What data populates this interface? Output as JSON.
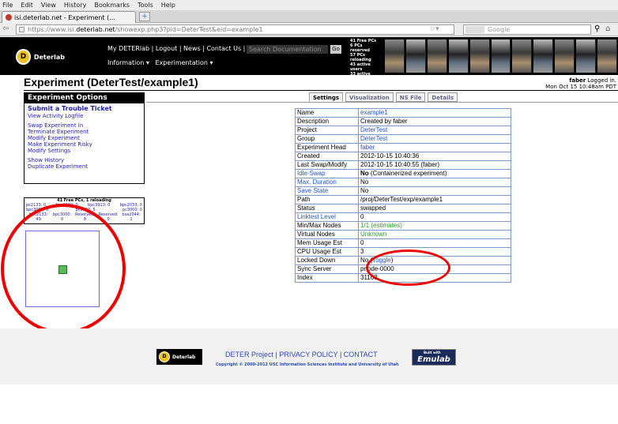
{
  "browser": {
    "menu": [
      "File",
      "Edit",
      "View",
      "History",
      "Bookmarks",
      "Tools",
      "Help"
    ],
    "tab_title": "isi.deterlab.net - Experiment (...",
    "new_tab": "+",
    "url_prefix": "https://www.isi.",
    "url_domain": "deterlab.net",
    "url_path": "/showexp.php3?pid=DeterTest&eid=example1",
    "search_placeholder": "Google"
  },
  "site": {
    "logo_text": "Deterlab",
    "logo_letter": "D",
    "toplinks": "My DETERlab | Logout | News | Contact Us |",
    "doc_search_placeholder": "Search Documentation",
    "go_label": "Go",
    "menu_information": "Information ▾",
    "menu_experimentation": "Experimentation ▾",
    "free_pcs": [
      "41 Free PCs",
      "6 PCs reserved",
      "57 PCs reloading",
      "43 active users",
      "33 active expts."
    ]
  },
  "page": {
    "title": "Experiment (DeterTest/example1)",
    "logged_in_user": "faber",
    "logged_in_suffix": " Logged in.",
    "datetime": "Mon Oct 15 10:48am PDT"
  },
  "sidebar": {
    "header": "Experiment Options",
    "items": [
      "Submit a Trouble Ticket",
      "View Activity Logfile",
      "Swap Experiment In",
      "Terminate Experiment",
      "Modify Experiment",
      "Make Experiment Risky",
      "Modify Settings",
      "Show History",
      "Duplicate Experiment"
    ],
    "freepcs_header": "41 Free PCs, 1 reloading",
    "freepcs_rows": [
      [
        "pc2133: 0",
        "bpc2000: 0",
        "bpc3913: 0",
        "bpc2033: 0"
      ],
      [
        "bpc3000: 0",
        "pc3060: 5",
        "pc3000: 0"
      ],
      [
        "bpc2133: 49",
        "bpc3000: 0",
        "Reserved: 8",
        "Reserved: 0",
        "bsa2044: 2"
      ]
    ]
  },
  "tabs": [
    "Settings",
    "Visualization",
    "NS File",
    "Details"
  ],
  "details": [
    {
      "key": "Name",
      "value": "example1"
    },
    {
      "key": "Description",
      "value": "Created by faber"
    },
    {
      "key": "Project",
      "value": "DeterTest"
    },
    {
      "key": "Group",
      "value": "DeterTest"
    },
    {
      "key": "Experiment Head",
      "value": "faber"
    },
    {
      "key": "Created",
      "value": "2012-10-15 10:40:36"
    },
    {
      "key": "Last Swap/Modify",
      "value": "2012-10-15 10:40:55 (faber)"
    },
    {
      "key": "Idle-Swap",
      "value": "No",
      "note": " (Containerized experiment)"
    },
    {
      "key": "Max. Duration",
      "value": "No"
    },
    {
      "key": "Save State",
      "value": "No"
    },
    {
      "key": "Path",
      "value": "/proj/DeterTest/exp/example1"
    },
    {
      "key": "Status",
      "value": "swapped"
    },
    {
      "key": "Linktest Level",
      "value": "0"
    },
    {
      "key": "Min/Max Nodes",
      "value": "1/1 (estimates)"
    },
    {
      "key": "Virtual Nodes",
      "value": "Unknown"
    },
    {
      "key": "Mem Usage Est",
      "value": "0"
    },
    {
      "key": "CPU Usage Est",
      "value": "3"
    },
    {
      "key": "Locked Down",
      "value": "No (",
      "toggle": "Toggle",
      "close": ")"
    },
    {
      "key": "Sync Server",
      "value": "pnode-0000"
    },
    {
      "key": "Index",
      "value": "31163"
    }
  ],
  "footer": {
    "link_project": "DETER Project",
    "link_privacy": "PRIVACY POLICY",
    "link_contact": "CONTACT",
    "sep": "|",
    "copyright": "Copyright © 2000-2012 USC Information Sciences Institute and University of Utah",
    "logo_text": "Deterlab",
    "emulab_built": "Built with",
    "emulab_text": "Emulab"
  }
}
